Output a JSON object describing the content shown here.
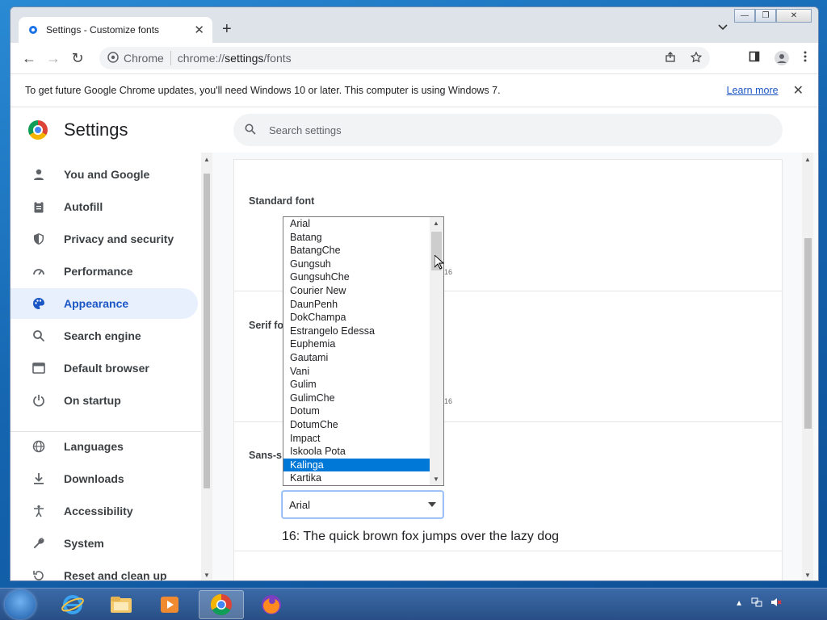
{
  "tab": {
    "title": "Settings - Customize fonts",
    "close": "✕",
    "new_tab": "+",
    "dropdown": "⌄"
  },
  "window_controls": {
    "minimize": "—",
    "restore": "❐",
    "close": "✕"
  },
  "toolbar": {
    "back": "←",
    "forward": "→",
    "reload": "↻",
    "site_label": "Chrome",
    "url_scheme": "chrome://",
    "url_host": "settings",
    "url_path": "/fonts"
  },
  "infobar": {
    "message": "To get future Google Chrome updates, you'll need Windows 10 or later. This computer is using Windows 7.",
    "link": "Learn more",
    "close": "✕"
  },
  "header": {
    "title": "Settings",
    "search_placeholder": "Search settings"
  },
  "sidebar": {
    "items": [
      {
        "label": "You and Google",
        "icon": "person-icon"
      },
      {
        "label": "Autofill",
        "icon": "clipboard-icon"
      },
      {
        "label": "Privacy and security",
        "icon": "shield-icon"
      },
      {
        "label": "Performance",
        "icon": "speedometer-icon"
      },
      {
        "label": "Appearance",
        "icon": "palette-icon"
      },
      {
        "label": "Search engine",
        "icon": "search-icon"
      },
      {
        "label": "Default browser",
        "icon": "browser-icon"
      },
      {
        "label": "On startup",
        "icon": "power-icon"
      },
      {
        "label": "Languages",
        "icon": "globe-icon"
      },
      {
        "label": "Downloads",
        "icon": "download-icon"
      },
      {
        "label": "Accessibility",
        "icon": "accessibility-icon"
      },
      {
        "label": "System",
        "icon": "wrench-icon"
      },
      {
        "label": "Reset and clean up",
        "icon": "reset-icon"
      }
    ],
    "selected": "Appearance"
  },
  "fonts": {
    "standard_label": "Standard font",
    "serif_label": "Serif fo",
    "sans_label": "Sans-s",
    "sans_value": "Arial",
    "sample": "16: The quick brown fox jumps over the lazy dog",
    "tick_mark": "16"
  },
  "font_list": {
    "options": [
      "Arial",
      "Batang",
      "BatangChe",
      "Gungsuh",
      "GungsuhChe",
      "Courier New",
      "DaunPenh",
      "DokChampa",
      "Estrangelo Edessa",
      "Euphemia",
      "Gautami",
      "Vani",
      "Gulim",
      "GulimChe",
      "Dotum",
      "DotumChe",
      "Impact",
      "Iskoola Pota",
      "Kalinga",
      "Kartika"
    ],
    "selected": "Kalinga"
  },
  "colors": {
    "accent": "#1a56c4",
    "selection": "#0078d7"
  }
}
